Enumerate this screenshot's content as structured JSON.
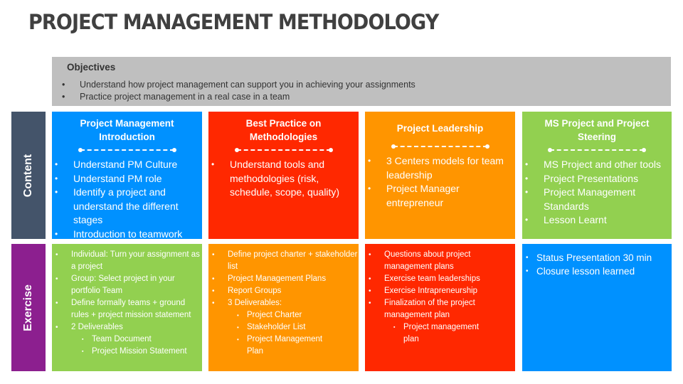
{
  "title": "PROJECT MANAGEMENT METHODOLOGY",
  "objectives": {
    "heading": "Objectives",
    "bullet": "•",
    "items": [
      "Understand how project management can support you in achieving your assignments",
      "Practice project management in a real case in a team"
    ]
  },
  "rows": {
    "content_label": "Content",
    "exercise_label": "Exercise"
  },
  "colors": {
    "content_label_bg": "#44546a",
    "exercise_label_bg": "#8c1f8f",
    "blue": "#0091ff",
    "red": "#ff2800",
    "orange": "#ff9500",
    "green": "#92d050",
    "objectives_bg": "#bfbfbf"
  },
  "bullets": {
    "round": "•",
    "square": "▪"
  },
  "content": [
    {
      "title": "Project Management Introduction",
      "items": [
        "Understand PM Culture",
        "Understand PM role",
        "Identify a project and understand the different stages",
        "Introduction to teamwork"
      ]
    },
    {
      "title": "Best Practice on Methodologies",
      "items": [
        "Understand tools and methodologies (risk, schedule, scope, quality)"
      ]
    },
    {
      "title": "Project Leadership",
      "items": [
        "3 Centers models for team leadership",
        "Project Manager entrepreneur"
      ]
    },
    {
      "title": "MS Project and Project Steering",
      "items": [
        "MS Project and other tools",
        "Project Presentations",
        "Project Management Standards",
        "Lesson Learnt"
      ]
    }
  ],
  "exercise": [
    {
      "items": [
        "Individual: Turn your assignment as a project",
        "Group: Select project in your portfolio Team",
        "Define formally teams + ground rules + project mission statement",
        "2 Deliverables"
      ],
      "subitems": [
        "Team Document",
        "Project Mission Statement"
      ]
    },
    {
      "items": [
        "Define project charter + stakeholder list",
        "Project Management Plans",
        "Report Groups",
        "3 Deliverables:"
      ],
      "subitems": [
        "Project Charter",
        "Stakeholder List",
        "Project Management Plan"
      ]
    },
    {
      "items": [
        "Questions about project management plans",
        "Exercise team leaderships",
        "Exercise Intrapreneurship",
        "Finalization of the project management plan"
      ],
      "subitems": [
        "Project management plan"
      ]
    },
    {
      "items": [
        "Status Presentation 30 min",
        "Closure lesson learned"
      ]
    }
  ]
}
